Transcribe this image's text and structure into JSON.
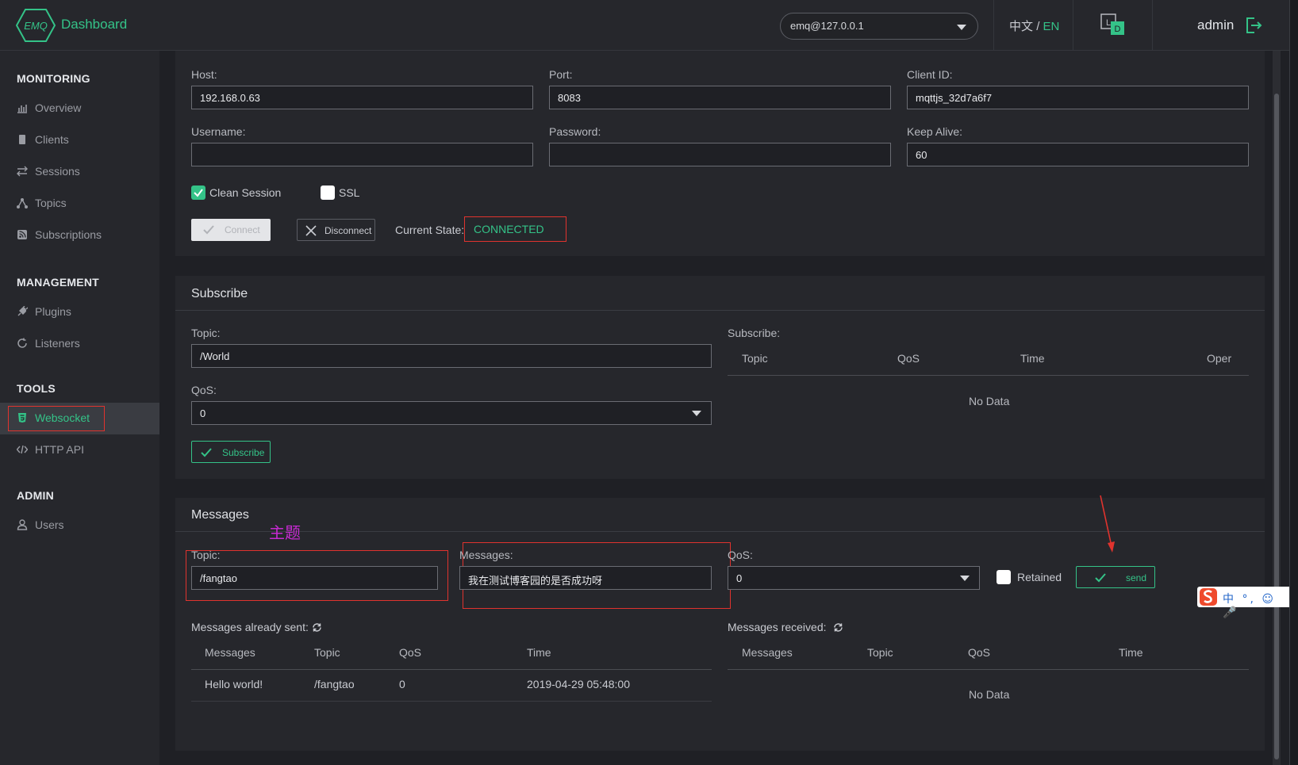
{
  "header": {
    "logo_text": "EMQ",
    "title": "Dashboard",
    "node": "emq@127.0.0.1",
    "lang_zh": "中文",
    "lang_sep": "/",
    "lang_en": "EN",
    "theme_l": "L",
    "theme_d": "D",
    "user": "admin"
  },
  "sidebar": {
    "groups": [
      "MONITORING",
      "MANAGEMENT",
      "TOOLS",
      "ADMIN"
    ],
    "items": [
      {
        "label": "Overview",
        "icon": "bar-chart-icon"
      },
      {
        "label": "Clients",
        "icon": "clients-icon"
      },
      {
        "label": "Sessions",
        "icon": "swap-icon"
      },
      {
        "label": "Topics",
        "icon": "topics-icon"
      },
      {
        "label": "Subscriptions",
        "icon": "rss-icon"
      },
      {
        "label": "Plugins",
        "icon": "plug-icon"
      },
      {
        "label": "Listeners",
        "icon": "refresh-icon"
      },
      {
        "label": "Websocket",
        "icon": "html5-icon"
      },
      {
        "label": "HTTP API",
        "icon": "code-icon"
      },
      {
        "label": "Users",
        "icon": "user-icon"
      }
    ]
  },
  "connect": {
    "host_label": "Host:",
    "host": "192.168.0.63",
    "port_label": "Port:",
    "port": "8083",
    "client_id_label": "Client ID:",
    "client_id": "mqttjs_32d7a6f7",
    "username_label": "Username:",
    "username": "",
    "password_label": "Password:",
    "password": "",
    "keepalive_label": "Keep Alive:",
    "keepalive": "60",
    "clean_session": "Clean Session",
    "ssl": "SSL",
    "connect_btn": "Connect",
    "disconnect_btn": "Disconnect",
    "state_label": "Current State:",
    "state": "CONNECTED"
  },
  "subscribe": {
    "title": "Subscribe",
    "topic_label": "Topic:",
    "topic": "/World",
    "qos_label": "QoS:",
    "qos": "0",
    "button": "Subscribe",
    "list_label": "Subscribe:",
    "columns": [
      "Topic",
      "QoS",
      "Time",
      "Oper"
    ],
    "empty": "No Data"
  },
  "messages": {
    "title": "Messages",
    "annotation": "主题",
    "topic_label": "Topic:",
    "topic": "/fangtao",
    "message_label": "Messages:",
    "message": "我在测试博客园的是否成功呀",
    "qos_label": "QoS:",
    "qos": "0",
    "retained": "Retained",
    "send": "send",
    "sent_label": "Messages already sent:",
    "sent_columns": [
      "Messages",
      "Topic",
      "QoS",
      "Time"
    ],
    "sent_rows": [
      {
        "message": "Hello world!",
        "topic": "/fangtao",
        "qos": "0",
        "time": "2019-04-29 05:48:00"
      }
    ],
    "received_label": "Messages received:",
    "received_columns": [
      "Messages",
      "Topic",
      "QoS",
      "Time"
    ],
    "received_empty": "No Data"
  },
  "ime": {
    "text": "中 °, ☺ 🎤"
  },
  "colors": {
    "accent": "#34c388",
    "annotation_red": "#e0332e",
    "annotation_purple": "#c62ad1"
  }
}
